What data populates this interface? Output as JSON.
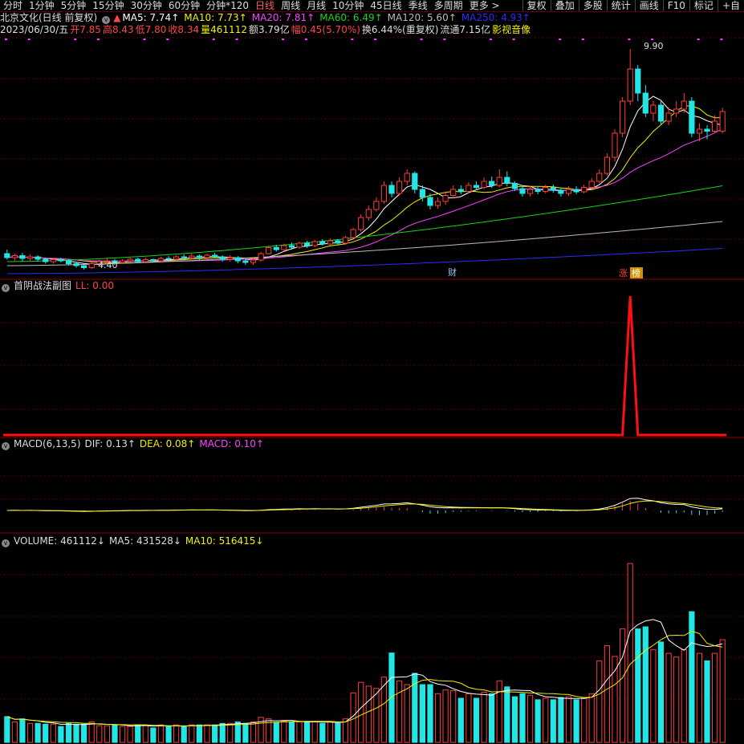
{
  "toolbar": {
    "tabs": [
      "分时",
      "1分钟",
      "5分钟",
      "15分钟",
      "30分钟",
      "60分钟",
      "分钟*120",
      "日线",
      "周线",
      "月线",
      "10分钟",
      "45日线",
      "季线",
      "多周期",
      "更多 >"
    ],
    "active_index": 7,
    "right_buttons": [
      "复权",
      "叠加",
      "多股",
      "统计",
      "画线",
      "F10",
      "标记",
      "+自"
    ]
  },
  "stock": {
    "title": "北京文化(日线 前复权)",
    "ma_labels": [
      {
        "text": "MA5: 7.74↑",
        "color": "#ffffff"
      },
      {
        "text": "MA10: 7.73↑",
        "color": "#f0f000"
      },
      {
        "text": "MA20: 7.81↑",
        "color": "#ff40ff"
      },
      {
        "text": "MA60: 6.49↑",
        "color": "#19d219"
      },
      {
        "text": "MA120: 5.60↑",
        "color": "#bbbbbb"
      },
      {
        "text": "MA250: 4.93↑",
        "color": "#2a2aff"
      }
    ],
    "quote": {
      "date": "2023/06/30/五",
      "open": "开7.85",
      "high": "高8.43",
      "low": "低7.80",
      "close": "收8.34",
      "vol": "量461112",
      "amount": "额3.79亿",
      "change": "幅0.45(5.70%)",
      "turnover": "换6.44%(重复权)",
      "float": "流通7.15亿",
      "sector": "影视音像"
    },
    "marks": {
      "high_label": "9.90",
      "low_label": "4.40",
      "cai": "财",
      "zhang": "涨",
      "bang": "榜"
    }
  },
  "subchart": {
    "title": "首阴战法副图",
    "ll_label": "LL: 0.00"
  },
  "macd": {
    "title": "MACD(6,13,5)",
    "dif": "DIF: 0.13↑",
    "dea": "DEA: 0.08↑",
    "macd": "MACD: 0.10↑"
  },
  "volume": {
    "title": "VOLUME: 461112↓",
    "ma5": "MA5: 431528↓",
    "ma10": "MA10: 516415↓"
  },
  "colors": {
    "up": "#ff3c3c",
    "down": "#22e5e5",
    "bg": "#000000",
    "grid": "#5a0000"
  },
  "chart_data": {
    "type": "candlestick",
    "price_range": [
      4.2,
      10.2
    ],
    "candles": [
      [
        4.8,
        4.7,
        4.9,
        4.65
      ],
      [
        4.7,
        4.75,
        4.8,
        4.62
      ],
      [
        4.75,
        4.68,
        4.82,
        4.6
      ],
      [
        4.68,
        4.72,
        4.78,
        4.62
      ],
      [
        4.72,
        4.66,
        4.76,
        4.6
      ],
      [
        4.66,
        4.6,
        4.7,
        4.55
      ],
      [
        4.6,
        4.65,
        4.7,
        4.55
      ],
      [
        4.65,
        4.62,
        4.7,
        4.58
      ],
      [
        4.62,
        4.55,
        4.66,
        4.5
      ],
      [
        4.55,
        4.5,
        4.6,
        4.45
      ],
      [
        4.5,
        4.45,
        4.55,
        4.4
      ],
      [
        4.45,
        4.55,
        4.6,
        4.42
      ],
      [
        4.55,
        4.6,
        4.65,
        4.52
      ],
      [
        4.6,
        4.62,
        4.68,
        4.55
      ],
      [
        4.62,
        4.58,
        4.66,
        4.52
      ],
      [
        4.58,
        4.62,
        4.66,
        4.54
      ],
      [
        4.62,
        4.66,
        4.7,
        4.58
      ],
      [
        4.66,
        4.6,
        4.7,
        4.56
      ],
      [
        4.6,
        4.65,
        4.7,
        4.56
      ],
      [
        4.65,
        4.62,
        4.68,
        4.58
      ],
      [
        4.62,
        4.68,
        4.72,
        4.58
      ],
      [
        4.68,
        4.66,
        4.74,
        4.62
      ],
      [
        4.66,
        4.72,
        4.76,
        4.62
      ],
      [
        4.72,
        4.7,
        4.78,
        4.66
      ],
      [
        4.7,
        4.74,
        4.8,
        4.66
      ],
      [
        4.74,
        4.7,
        4.78,
        4.64
      ],
      [
        4.7,
        4.76,
        4.8,
        4.66
      ],
      [
        4.76,
        4.72,
        4.82,
        4.68
      ],
      [
        4.72,
        4.66,
        4.76,
        4.6
      ],
      [
        4.66,
        4.7,
        4.76,
        4.6
      ],
      [
        4.7,
        4.62,
        4.74,
        4.56
      ],
      [
        4.62,
        4.58,
        4.68,
        4.52
      ],
      [
        4.58,
        4.64,
        4.7,
        4.52
      ],
      [
        4.64,
        4.8,
        4.84,
        4.6
      ],
      [
        4.8,
        4.95,
        5.0,
        4.78
      ],
      [
        4.95,
        4.9,
        5.02,
        4.85
      ],
      [
        4.9,
        5.0,
        5.05,
        4.86
      ],
      [
        5.0,
        4.96,
        5.08,
        4.9
      ],
      [
        4.96,
        5.06,
        5.1,
        4.92
      ],
      [
        5.06,
        5.0,
        5.12,
        4.94
      ],
      [
        5.0,
        5.1,
        5.14,
        4.96
      ],
      [
        5.1,
        5.04,
        5.16,
        5.0
      ],
      [
        5.04,
        5.12,
        5.18,
        5.0
      ],
      [
        5.12,
        5.06,
        5.16,
        5.0
      ],
      [
        5.06,
        5.2,
        5.24,
        5.02
      ],
      [
        5.2,
        5.4,
        5.45,
        5.16
      ],
      [
        5.4,
        5.7,
        5.78,
        5.35
      ],
      [
        5.7,
        5.9,
        6.0,
        5.62
      ],
      [
        5.9,
        6.1,
        6.2,
        5.85
      ],
      [
        6.1,
        6.5,
        6.6,
        6.05
      ],
      [
        6.5,
        6.3,
        6.6,
        6.2
      ],
      [
        6.3,
        6.6,
        6.7,
        6.25
      ],
      [
        6.6,
        6.8,
        6.9,
        6.5
      ],
      [
        6.8,
        6.4,
        6.85,
        6.3
      ],
      [
        6.4,
        6.2,
        6.5,
        6.1
      ],
      [
        6.2,
        6.0,
        6.3,
        5.9
      ],
      [
        6.0,
        6.1,
        6.2,
        5.92
      ],
      [
        6.1,
        6.25,
        6.35,
        6.02
      ],
      [
        6.25,
        6.4,
        6.5,
        6.18
      ],
      [
        6.4,
        6.35,
        6.5,
        6.28
      ],
      [
        6.35,
        6.5,
        6.58,
        6.3
      ],
      [
        6.5,
        6.45,
        6.6,
        6.38
      ],
      [
        6.45,
        6.6,
        6.7,
        6.4
      ],
      [
        6.6,
        6.5,
        6.72,
        6.44
      ],
      [
        6.5,
        6.7,
        6.9,
        6.45
      ],
      [
        6.7,
        6.55,
        6.85,
        6.48
      ],
      [
        6.55,
        6.42,
        6.6,
        6.36
      ],
      [
        6.42,
        6.3,
        6.5,
        6.22
      ],
      [
        6.3,
        6.4,
        6.48,
        6.22
      ],
      [
        6.4,
        6.35,
        6.48,
        6.28
      ],
      [
        6.35,
        6.45,
        6.52,
        6.3
      ],
      [
        6.45,
        6.38,
        6.52,
        6.32
      ],
      [
        6.38,
        6.3,
        6.45,
        6.22
      ],
      [
        6.3,
        6.4,
        6.48,
        6.24
      ],
      [
        6.4,
        6.34,
        6.48,
        6.28
      ],
      [
        6.34,
        6.45,
        6.52,
        6.3
      ],
      [
        6.45,
        6.6,
        6.68,
        6.4
      ],
      [
        6.6,
        6.8,
        6.9,
        6.55
      ],
      [
        6.8,
        7.2,
        7.3,
        6.75
      ],
      [
        7.2,
        7.8,
        7.9,
        7.1
      ],
      [
        7.8,
        8.6,
        8.7,
        7.7
      ],
      [
        8.6,
        9.4,
        9.9,
        8.5
      ],
      [
        9.4,
        8.8,
        9.5,
        8.6
      ],
      [
        8.8,
        8.3,
        9.0,
        8.2
      ],
      [
        8.3,
        8.5,
        8.6,
        8.1
      ],
      [
        8.5,
        8.1,
        8.6,
        8.0
      ],
      [
        8.1,
        8.3,
        8.45,
        8.0
      ],
      [
        8.3,
        8.4,
        8.6,
        8.2
      ],
      [
        8.4,
        8.6,
        8.8,
        8.3
      ],
      [
        8.6,
        7.8,
        8.7,
        7.7
      ],
      [
        7.8,
        7.9,
        8.05,
        7.6
      ],
      [
        7.9,
        7.85,
        8.0,
        7.65
      ],
      [
        7.85,
        8.1,
        8.25,
        7.8
      ],
      [
        7.85,
        8.34,
        8.43,
        7.8
      ]
    ]
  }
}
